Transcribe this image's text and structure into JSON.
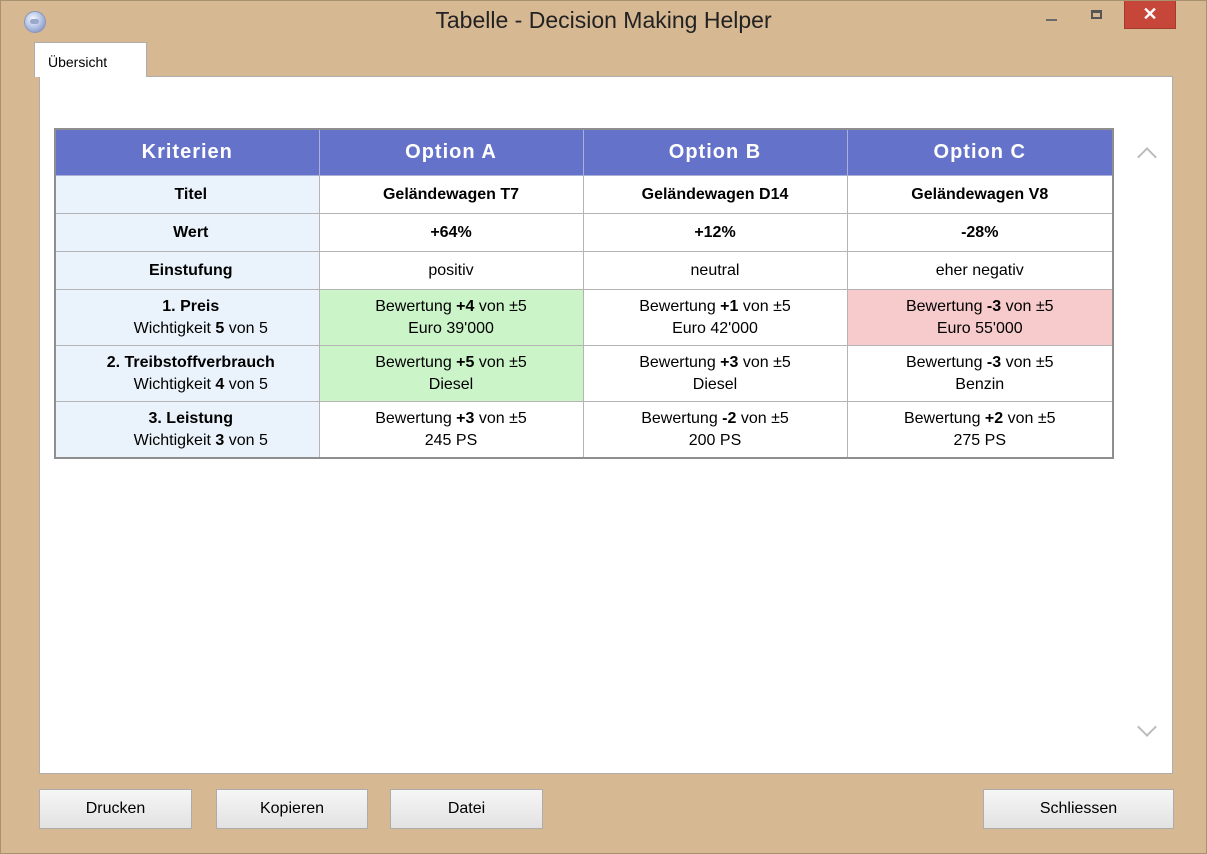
{
  "window": {
    "title": "Tabelle - Decision Making Helper",
    "close_glyph": "✕",
    "icons": [
      "app-icon",
      "minimize-icon",
      "maximize-icon",
      "close-icon"
    ]
  },
  "tabs": [
    {
      "label": "Übersicht",
      "selected": true
    }
  ],
  "table": {
    "headers": [
      "Kriterien",
      "Option A",
      "Option B",
      "Option C"
    ],
    "title_row": {
      "label": "Titel",
      "values": [
        "Geländewagen T7",
        "Geländewagen D14",
        "Geländewagen V8"
      ]
    },
    "wert_row": {
      "label": "Wert",
      "values": [
        "+64%",
        "+12%",
        "-28%"
      ]
    },
    "einstufung_row": {
      "label": "Einstufung",
      "values": [
        "positiv",
        "neutral",
        "eher negativ"
      ]
    },
    "criteria": [
      {
        "title": "1. Preis",
        "weight_prefix": "Wichtigkeit ",
        "weight": "5",
        "weight_suffix": " von 5",
        "cells": [
          {
            "prefix": "Bewertung ",
            "score": "+4",
            "suffix": " von ±5",
            "detail": "Euro 39'000",
            "highlight": "green"
          },
          {
            "prefix": "Bewertung ",
            "score": "+1",
            "suffix": " von ±5",
            "detail": "Euro 42'000",
            "highlight": "none"
          },
          {
            "prefix": "Bewertung ",
            "score": "-3",
            "suffix": " von ±5",
            "detail": "Euro 55'000",
            "highlight": "red"
          }
        ]
      },
      {
        "title": "2. Treibstoffverbrauch",
        "weight_prefix": "Wichtigkeit ",
        "weight": "4",
        "weight_suffix": " von 5",
        "cells": [
          {
            "prefix": "Bewertung ",
            "score": "+5",
            "suffix": " von ±5",
            "detail": "Diesel",
            "highlight": "green"
          },
          {
            "prefix": "Bewertung ",
            "score": "+3",
            "suffix": " von ±5",
            "detail": "Diesel",
            "highlight": "none"
          },
          {
            "prefix": "Bewertung ",
            "score": "-3",
            "suffix": " von ±5",
            "detail": "Benzin",
            "highlight": "none"
          }
        ]
      },
      {
        "title": "3. Leistung",
        "weight_prefix": "Wichtigkeit ",
        "weight": "3",
        "weight_suffix": " von 5",
        "cells": [
          {
            "prefix": "Bewertung ",
            "score": "+3",
            "suffix": " von ±5",
            "detail": "245 PS",
            "highlight": "none"
          },
          {
            "prefix": "Bewertung ",
            "score": "-2",
            "suffix": " von ±5",
            "detail": "200 PS",
            "highlight": "none"
          },
          {
            "prefix": "Bewertung ",
            "score": "+2",
            "suffix": " von ±5",
            "detail": "275 PS",
            "highlight": "none"
          }
        ]
      }
    ]
  },
  "buttons": {
    "print": "Drucken",
    "copy": "Kopieren",
    "file": "Datei",
    "close": "Schliessen"
  },
  "colors": {
    "header_bg": "#6472c9",
    "positive": "#ccf4c9",
    "negative": "#f7cbcb",
    "row_header_bg": "#eaf3fc",
    "close_button": "#c7463a"
  }
}
